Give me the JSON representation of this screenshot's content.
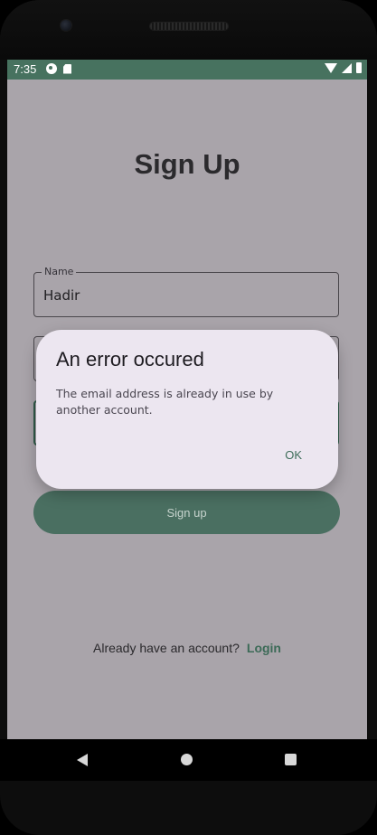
{
  "status_bar": {
    "time": "7:35",
    "left_icons": [
      "data-saver-icon",
      "sd-card-icon"
    ],
    "right_icons": [
      "wifi-icon",
      "signal-icon",
      "battery-icon"
    ]
  },
  "page": {
    "title": "Sign Up"
  },
  "form": {
    "name": {
      "label": "Name",
      "value": "Hadir"
    },
    "email": {
      "label": "",
      "value": ""
    },
    "password": {
      "label": "",
      "value": ""
    }
  },
  "signup_button": {
    "label": "Sign up"
  },
  "login_prompt": {
    "text": "Already have an account?",
    "link": "Login"
  },
  "dialog": {
    "title": "An error occured",
    "message": "The email address is already in use by another account.",
    "ok_label": "OK"
  },
  "colors": {
    "accent": "#47725f",
    "scrim_background": "#a9a4aa",
    "dialog_background": "#ece6f0"
  }
}
